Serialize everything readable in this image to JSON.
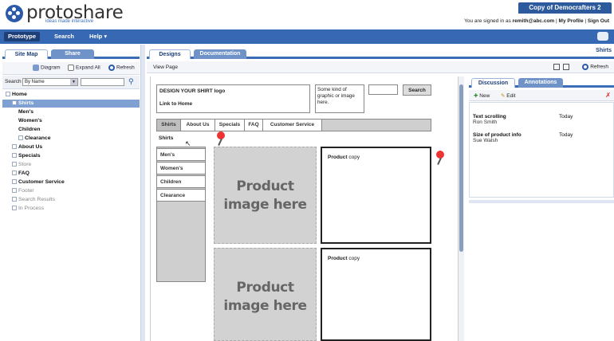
{
  "app": {
    "logo": "protoshare",
    "tagline": "ideas made interactive",
    "project_tab": "Copy of Democrafters 2",
    "signed_in_prefix": "You are signed in as",
    "user_email": "remith@abc.com",
    "my_profile": "My Profile",
    "sign_out": "Sign Out"
  },
  "nav": {
    "prototype": "Prototype",
    "search": "Search",
    "help": "Help ▾"
  },
  "left": {
    "tabs": [
      "Site Map",
      "Share"
    ],
    "diagram": "Diagram",
    "expand_all": "Expand All",
    "refresh": "Refresh",
    "search_label": "Search",
    "search_by": "By Name",
    "tree": [
      {
        "label": "Home",
        "level": 0,
        "style": "bold"
      },
      {
        "label": "Shirts",
        "level": 1,
        "style": "selected"
      },
      {
        "label": "Men's",
        "level": 2,
        "style": "bold"
      },
      {
        "label": "Women's",
        "level": 2,
        "style": "bold"
      },
      {
        "label": "Children",
        "level": 2,
        "style": "bold"
      },
      {
        "label": "Clearance",
        "level": 2,
        "style": "bold"
      },
      {
        "label": "About Us",
        "level": 1,
        "style": "bold"
      },
      {
        "label": "Specials",
        "level": 1,
        "style": "bold"
      },
      {
        "label": "Store",
        "level": 1,
        "style": "dim"
      },
      {
        "label": "FAQ",
        "level": 1,
        "style": "bold"
      },
      {
        "label": "Customer Service",
        "level": 1,
        "style": "bold"
      },
      {
        "label": "Footer",
        "level": 1,
        "style": "dim"
      },
      {
        "label": "Search Results",
        "level": 1,
        "style": "dim"
      },
      {
        "label": "In Process",
        "level": 1,
        "style": "dim"
      }
    ]
  },
  "center": {
    "tabs": [
      "Designs",
      "Documentation"
    ],
    "view_page": "View Page",
    "page_title": "Shirts",
    "refresh": "Refresh"
  },
  "wireframe": {
    "logo_line1": "DESIGN YOUR SHIRT logo",
    "logo_line2": "Link to Home",
    "graphic_text": "Some kind of graphic or image here.",
    "search_button": "Search",
    "tabs": [
      "Shirts",
      "About Us",
      "Specials",
      "FAQ",
      "Customer Service"
    ],
    "section_heading": "Shirts",
    "left_nav": [
      "Men's",
      "Women's",
      "Children",
      "Clearance"
    ],
    "product_image": "Product image here",
    "product_copy_bold": "Product",
    "product_copy_rest": " copy"
  },
  "right": {
    "tabs": [
      "Discussion",
      "Annotations"
    ],
    "new": "New",
    "edit": "Edit",
    "items": [
      {
        "title": "Text scrolling",
        "author": "Ron Smith",
        "date": "Today"
      },
      {
        "title": "Size of product info",
        "author": "Sue Walsh",
        "date": "Today"
      }
    ]
  },
  "colors": {
    "brand_blue": "#3668b3",
    "dark_blue": "#1e3f78",
    "selection": "#7ea0d3",
    "pin_red": "#e33333"
  }
}
